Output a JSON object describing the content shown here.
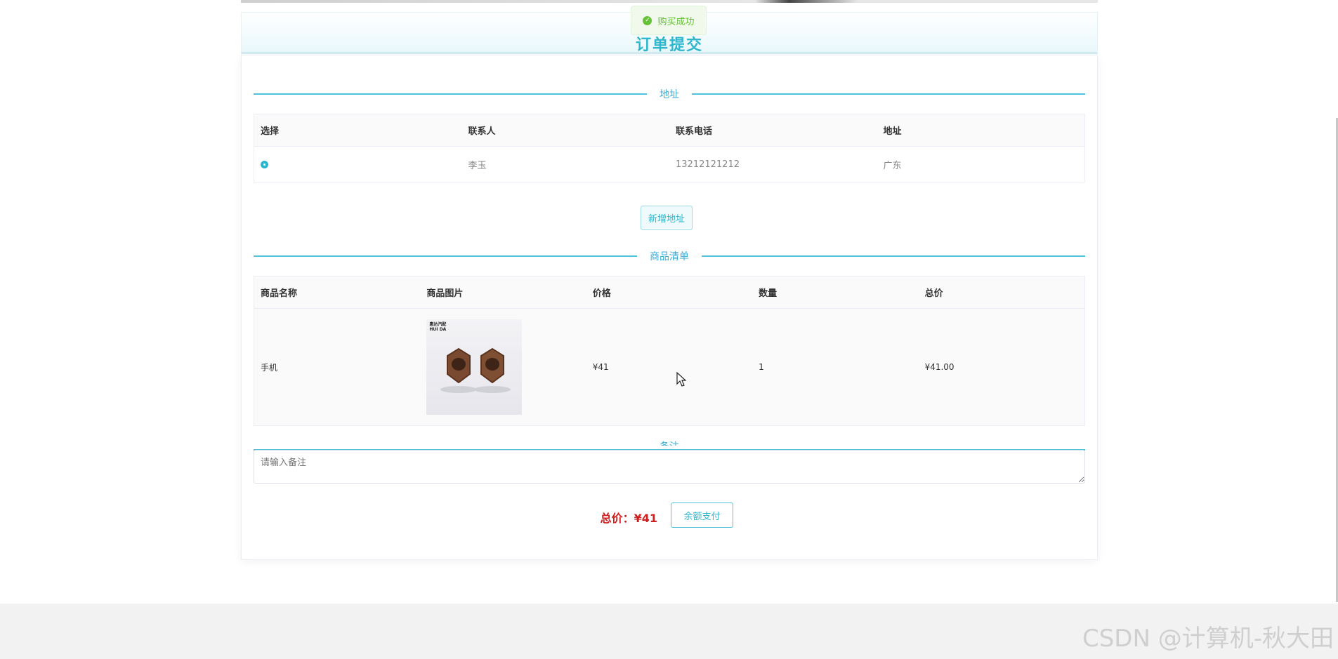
{
  "header": {
    "title": "订单提交"
  },
  "toast": {
    "message": "购买成功",
    "type": "success"
  },
  "address_section": {
    "label": "地址",
    "columns": [
      "选择",
      "联系人",
      "联系电话",
      "地址"
    ],
    "rows": [
      {
        "selected": true,
        "contact": "李玉",
        "phone": "13212121212",
        "address": "广东"
      }
    ],
    "add_button_label": "新增地址"
  },
  "goods_section": {
    "label": "商品清单",
    "columns": [
      "商品名称",
      "商品图片",
      "价格",
      "数量",
      "总价"
    ],
    "rows": [
      {
        "name": "手机",
        "image_brand": "惠达汽配\nHUI DA",
        "price": "¥41",
        "quantity": "1",
        "subtotal": "¥41.00"
      }
    ]
  },
  "remark": {
    "label": "备注",
    "placeholder": "请输入备注"
  },
  "checkout": {
    "total_label": "总价：",
    "total_value": "¥41",
    "pay_button_label": "余额支付"
  },
  "watermark": "CSDN @计算机-秋大田",
  "colors": {
    "accent": "#2fb6cc",
    "divider": "#4fc1d8",
    "success": "#67c23a",
    "price": "#d01f1f"
  }
}
